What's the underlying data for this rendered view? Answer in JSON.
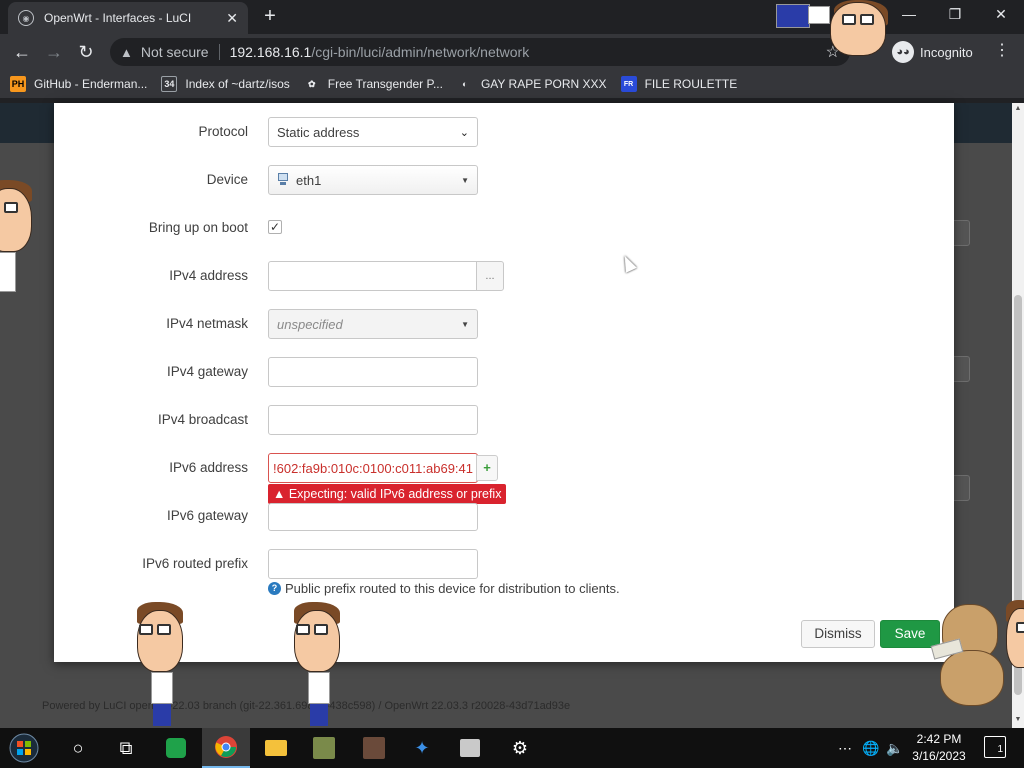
{
  "browser": {
    "tab_title": "OpenWrt - Interfaces - LuCI",
    "tab_close": "✕",
    "new_tab": "+",
    "window": {
      "minimize": "—",
      "maximize": "❐",
      "close": "✕"
    },
    "not_secure": "Not secure",
    "url_host": "192.168.16.1",
    "url_path": "/cgi-bin/luci/admin/network/network",
    "incognito_label": "Incognito",
    "bookmarks": [
      {
        "icon": "PH",
        "label": "GitHub - Enderman...",
        "icon_bg": "#f7971d",
        "icon_fg": "#000"
      },
      {
        "icon": "34",
        "label": "Index of ~dartz/isos",
        "icon_bg": "#35363a",
        "icon_fg": "#e8eaed"
      },
      {
        "icon": "✿",
        "label": "Free Transgender P...",
        "icon_bg": "#35363a",
        "icon_fg": "#e8eaed"
      },
      {
        "icon": "◐",
        "label": "GAY RAPE PORN XXX",
        "icon_bg": "#35363a",
        "icon_fg": "#e8eaed"
      },
      {
        "icon": "FR",
        "label": "FILE ROULETTE",
        "icon_bg": "#2a4bd8",
        "icon_fg": "#fff"
      }
    ]
  },
  "dialog": {
    "protocol": {
      "label": "Protocol",
      "value": "Static address"
    },
    "device": {
      "label": "Device",
      "value": "eth1"
    },
    "bring_up": {
      "label": "Bring up on boot",
      "checked": "✓"
    },
    "ipv4_address": {
      "label": "IPv4 address",
      "value": "",
      "button": "..."
    },
    "ipv4_netmask": {
      "label": "IPv4 netmask",
      "value": "unspecified"
    },
    "ipv4_gateway": {
      "label": "IPv4 gateway",
      "value": ""
    },
    "ipv4_broadcast": {
      "label": "IPv4 broadcast",
      "value": ""
    },
    "ipv6_address": {
      "label": "IPv6 address",
      "value": "!602:fa9b:010c:0100:c011:ab69:41",
      "add": "+"
    },
    "ipv6_error": "▲ Expecting: valid IPv6 address or prefix",
    "ipv6_gateway": {
      "label": "IPv6 gateway",
      "value": ""
    },
    "ipv6_prefix": {
      "label": "IPv6 routed prefix",
      "value": "",
      "hint": "Public prefix routed to this device for distribution to clients."
    },
    "dismiss": "Dismiss",
    "save": "Save"
  },
  "page": {
    "footer": "Powered by LuCI openwrt-22.03 branch (git-22.361.69894-438c598) / OpenWrt 22.03.3 r20028-43d71ad93e"
  },
  "taskbar": {
    "time": "2:42 PM",
    "date": "3/16/2023",
    "notifications": "1"
  }
}
